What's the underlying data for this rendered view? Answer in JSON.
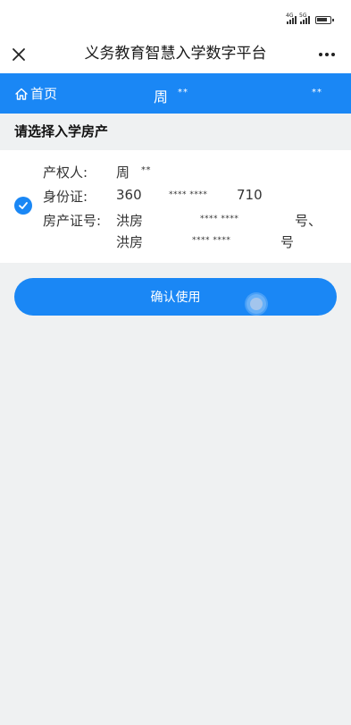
{
  "status_bar": {
    "signal1_label": "4G",
    "signal2_label": "5G"
  },
  "header": {
    "title": "义务教育智慧入学数字平台"
  },
  "nav_bar": {
    "home_label": "首页",
    "user_name": "周",
    "user_mask": "**",
    "right_mask": "**"
  },
  "section": {
    "title": "请选择入学房产"
  },
  "property": {
    "owner_label": "产权人:",
    "owner_name": "周",
    "owner_mask": "**",
    "id_label": "身份证:",
    "id_prefix": "360",
    "id_mask": "**** ****",
    "id_suffix": "710",
    "cert_label": "房产证号:",
    "cert1_prefix": "洪房",
    "cert1_mask": "**** ****",
    "cert1_suffix": "号、",
    "cert2_prefix": "洪房",
    "cert2_mask": "**** ****",
    "cert2_suffix": "号",
    "selected": true
  },
  "actions": {
    "confirm_label": "确认使用"
  },
  "colors": {
    "accent": "#1a87f5",
    "background": "#eff1f2"
  }
}
